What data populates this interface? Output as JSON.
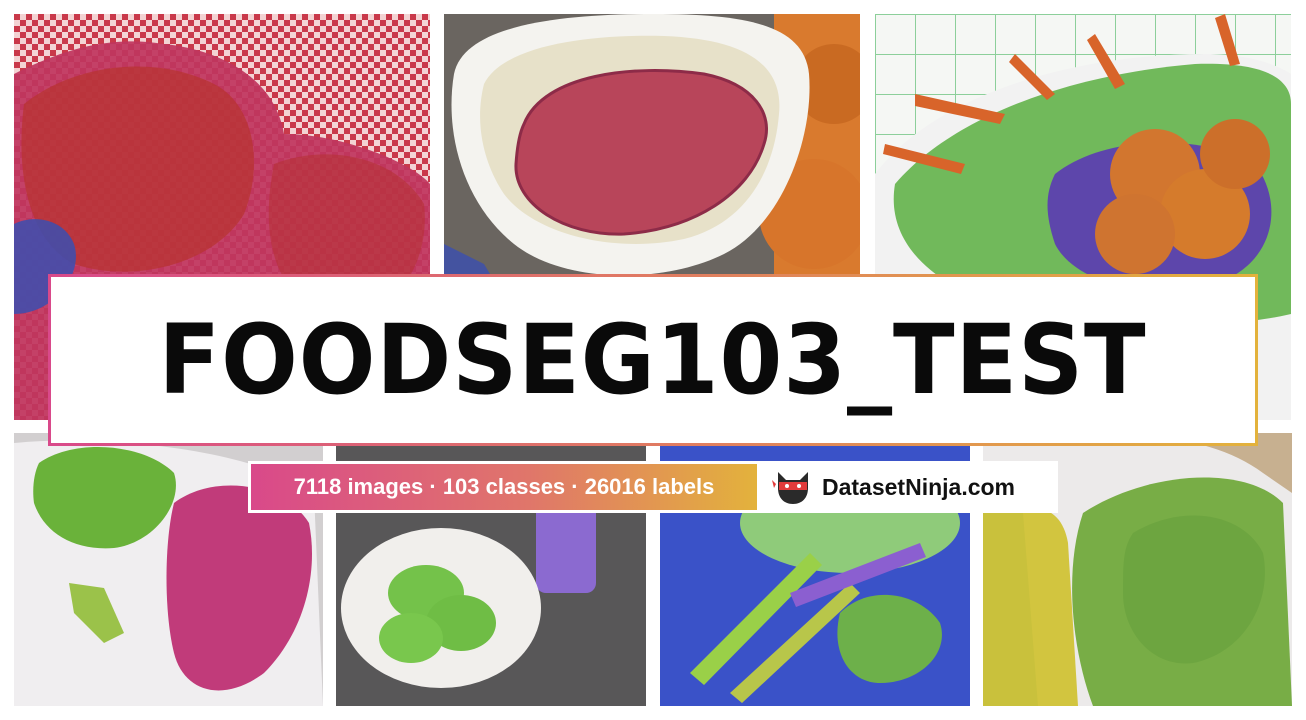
{
  "title": "FOODSEG103_TEST",
  "stats": {
    "text": "7118 images · 103 classes · 26016 labels"
  },
  "brand": {
    "name": "DatasetNinja.com",
    "logo_icon": "ninja-cat-icon"
  },
  "colors": {
    "gradient_start": "#d9498a",
    "gradient_mid": "#e07a62",
    "gradient_end": "#e3b23c",
    "title_text": "#0a0a0a"
  },
  "tiles": [
    {
      "name": "meat-on-checkered-cloth"
    },
    {
      "name": "sauce-bowl"
    },
    {
      "name": "vegetable-plate"
    },
    {
      "name": "lettuce-and-meat-plate"
    },
    {
      "name": "pancakes-and-drink"
    },
    {
      "name": "asparagus-and-lettuce"
    },
    {
      "name": "carrots-and-greens"
    }
  ]
}
